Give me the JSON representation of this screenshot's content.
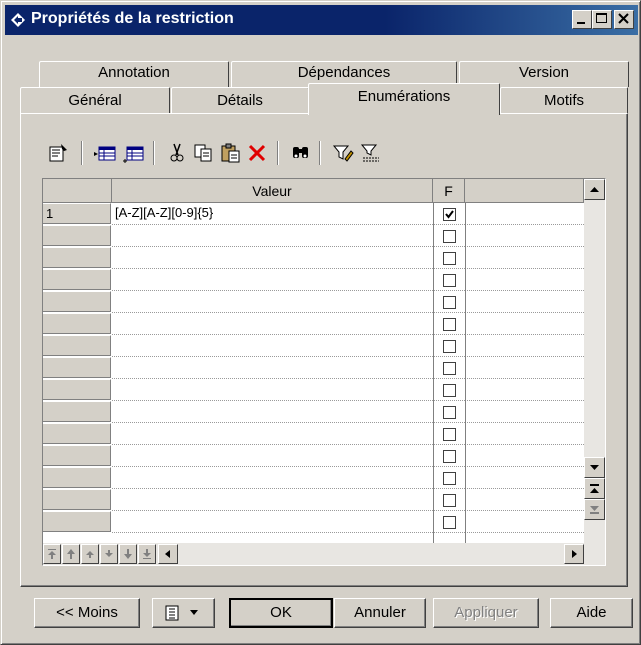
{
  "window": {
    "title": "Propriétés de la restriction"
  },
  "tabs": {
    "row1": [
      "Annotation",
      "Dépendances",
      "Version"
    ],
    "row2": [
      "Général",
      "Détails",
      "Enumérations",
      "Motifs"
    ],
    "active": "Enumérations"
  },
  "toolbar": {
    "icons": [
      "properties-icon",
      "insert-row-icon",
      "add-row-icon",
      "cut-icon",
      "copy-icon",
      "paste-icon",
      "delete-icon",
      "find-icon",
      "filter-icon",
      "clear-filter-icon"
    ]
  },
  "grid": {
    "columns": {
      "value": "Valeur",
      "flag": "F",
      "extra": ""
    },
    "rows": [
      {
        "num": "1",
        "value": "[A-Z][A-Z][0-9]{5}",
        "checked": true
      },
      {
        "num": "",
        "value": "",
        "checked": false
      },
      {
        "num": "",
        "value": "",
        "checked": false
      },
      {
        "num": "",
        "value": "",
        "checked": false
      },
      {
        "num": "",
        "value": "",
        "checked": false
      },
      {
        "num": "",
        "value": "",
        "checked": false
      },
      {
        "num": "",
        "value": "",
        "checked": false
      },
      {
        "num": "",
        "value": "",
        "checked": false
      },
      {
        "num": "",
        "value": "",
        "checked": false
      },
      {
        "num": "",
        "value": "",
        "checked": false
      },
      {
        "num": "",
        "value": "",
        "checked": false
      },
      {
        "num": "",
        "value": "",
        "checked": false
      },
      {
        "num": "",
        "value": "",
        "checked": false
      },
      {
        "num": "",
        "value": "",
        "checked": false
      },
      {
        "num": "",
        "value": "",
        "checked": false
      }
    ]
  },
  "buttons": {
    "less": "<< Moins",
    "ok": "OK",
    "cancel": "Annuler",
    "apply": "Appliquer",
    "help": "Aide"
  }
}
